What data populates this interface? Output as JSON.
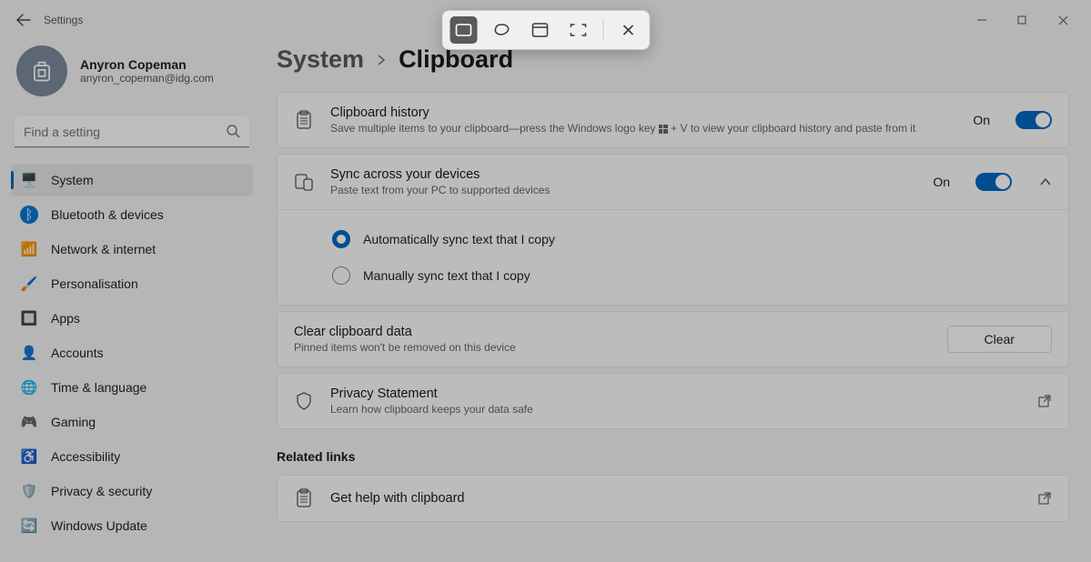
{
  "app": {
    "title": "Settings"
  },
  "profile": {
    "name": "Anyron Copeman",
    "email": "anyron_copeman@idg.com"
  },
  "search": {
    "placeholder": "Find a setting"
  },
  "nav": {
    "items": [
      {
        "label": "System",
        "icon": "🖥️",
        "active": true
      },
      {
        "label": "Bluetooth & devices",
        "icon": "ᛒ"
      },
      {
        "label": "Network & internet",
        "icon": "📶"
      },
      {
        "label": "Personalisation",
        "icon": "🖌️"
      },
      {
        "label": "Apps",
        "icon": "🔲"
      },
      {
        "label": "Accounts",
        "icon": "👤"
      },
      {
        "label": "Time & language",
        "icon": "🌐"
      },
      {
        "label": "Gaming",
        "icon": "🎮"
      },
      {
        "label": "Accessibility",
        "icon": "♿"
      },
      {
        "label": "Privacy & security",
        "icon": "🛡️"
      },
      {
        "label": "Windows Update",
        "icon": "🔄"
      }
    ]
  },
  "breadcrumb": {
    "parent": "System",
    "page": "Clipboard"
  },
  "cards": {
    "history": {
      "title": "Clipboard history",
      "sub_pre": "Save multiple items to your clipboard—press the Windows logo key ",
      "sub_post": " + V to view your clipboard history and paste from it",
      "state": "On"
    },
    "sync": {
      "title": "Sync across your devices",
      "sub": "Paste text from your PC to supported devices",
      "state": "On",
      "option_auto": "Automatically sync text that I copy",
      "option_manual": "Manually sync text that I copy"
    },
    "clear": {
      "title": "Clear clipboard data",
      "sub": "Pinned items won't be removed on this device",
      "button": "Clear"
    },
    "privacy": {
      "title": "Privacy Statement",
      "sub": "Learn how clipboard keeps your data safe"
    },
    "help": {
      "title": "Get help with clipboard"
    }
  },
  "related": {
    "heading": "Related links"
  },
  "snip": {
    "modes": [
      "rectangle",
      "freeform",
      "window",
      "fullscreen"
    ],
    "close": "close"
  }
}
